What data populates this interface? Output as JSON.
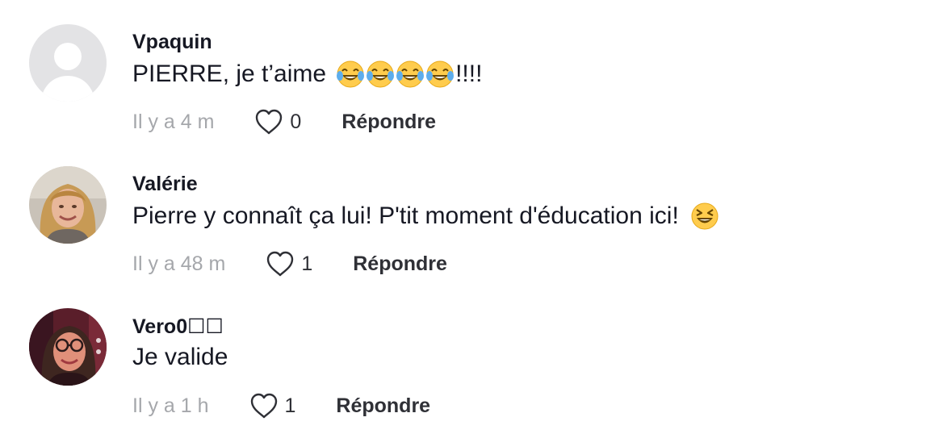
{
  "comments": [
    {
      "username": "Vpaquin",
      "text": "PIERRE, je t’aime",
      "text_suffix": "!!!!",
      "emojis": [
        "face-with-tears-of-joy-emoji",
        "face-with-tears-of-joy-emoji",
        "face-with-tears-of-joy-emoji",
        "face-with-tears-of-joy-emoji"
      ],
      "time": "Il y a 4 m",
      "likes": "0",
      "reply_label": "Répondre",
      "avatar": "default-avatar"
    },
    {
      "username": "Valérie",
      "text": "Pierre y connaît ça lui! P'tit moment d'éducation ici!",
      "emojis": [
        "grinning-squinting-face-emoji"
      ],
      "time": "Il y a 48 m",
      "likes": "1",
      "reply_label": "Répondre",
      "avatar": "user-photo"
    },
    {
      "username": "Vero0☐☐",
      "text": "Je valide",
      "time": "Il y a 1 h",
      "likes": "1",
      "reply_label": "Répondre",
      "avatar": "user-photo"
    }
  ],
  "colors": {
    "text_primary": "#161823",
    "text_secondary": "#a5a7ab",
    "action_text": "#2f3036",
    "avatar_placeholder": "#e3e3e5"
  },
  "icons": {
    "like": "heart-outline-icon"
  }
}
